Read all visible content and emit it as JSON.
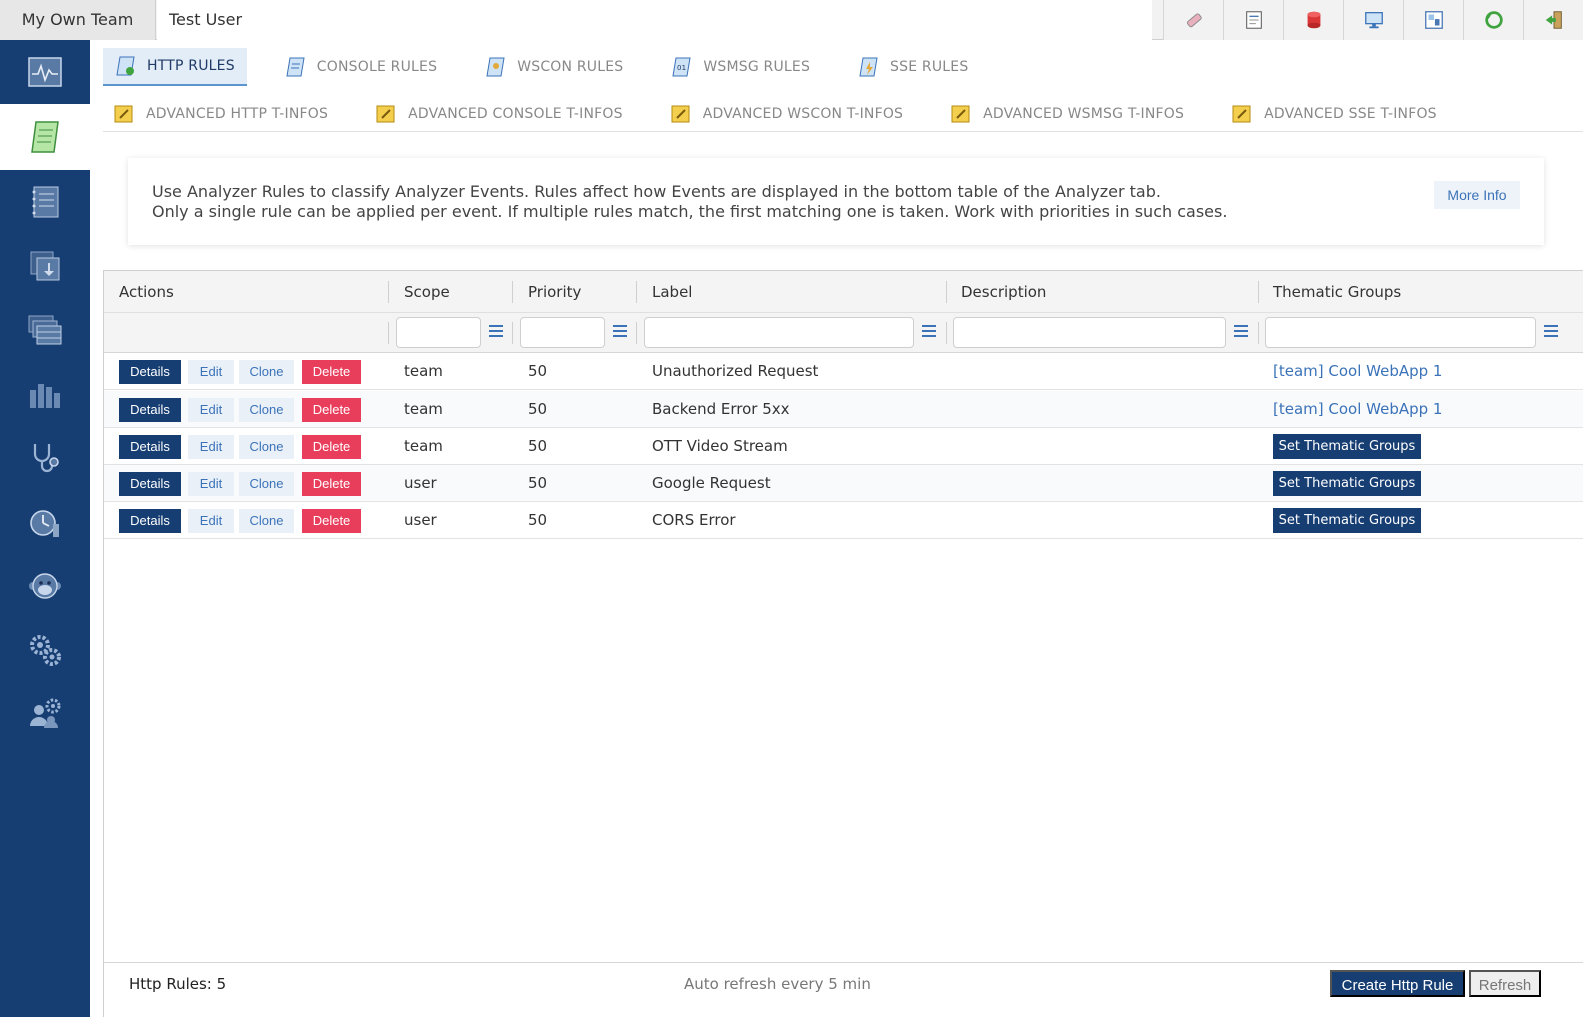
{
  "topbar": {
    "team": "My Own Team",
    "user": "Test User",
    "icons": [
      "eraser-icon",
      "report-icon",
      "database-icon",
      "monitor-icon",
      "layout-icon",
      "refresh-cycle-icon",
      "logout-icon"
    ]
  },
  "sidebar": {
    "items": [
      "analyzer-icon",
      "rules-scroll-icon",
      "notebook-icon",
      "download-icon",
      "tables-icon",
      "stats-icon",
      "stethoscope-icon",
      "timer-icon",
      "monkey-icon",
      "settings-gears-icon",
      "admin-users-icon"
    ],
    "active_index": 1
  },
  "tabs_primary": [
    {
      "label": "HTTP RULES",
      "active": true
    },
    {
      "label": "CONSOLE RULES"
    },
    {
      "label": "WSCON RULES"
    },
    {
      "label": "WSMSG RULES"
    },
    {
      "label": "SSE RULES"
    }
  ],
  "tabs_secondary": [
    {
      "label": "ADVANCED HTTP T-INFOS"
    },
    {
      "label": "ADVANCED CONSOLE T-INFOS"
    },
    {
      "label": "ADVANCED WSCON T-INFOS"
    },
    {
      "label": "ADVANCED WSMSG T-INFOS"
    },
    {
      "label": "ADVANCED SSE T-INFOS"
    }
  ],
  "info": {
    "line1": "Use Analyzer Rules to classify Analyzer Events. Rules affect how Events are displayed in the bottom table of the Analyzer tab.",
    "line2": "Only a single rule can be applied per event. If multiple rules match, the first matching one is taken. Work with priorities in such cases.",
    "more_info": "More Info"
  },
  "table": {
    "columns": [
      "Actions",
      "Scope",
      "Priority",
      "Label",
      "Description",
      "Thematic Groups"
    ],
    "action_labels": {
      "details": "Details",
      "edit": "Edit",
      "clone": "Clone",
      "delete": "Delete"
    },
    "set_groups_label": "Set Thematic Groups",
    "rows": [
      {
        "scope": "team",
        "priority": "50",
        "label": "Unauthorized Request",
        "description": "",
        "group": "[team] Cool WebApp 1"
      },
      {
        "scope": "team",
        "priority": "50",
        "label": "Backend Error 5xx",
        "description": "",
        "group": "[team] Cool WebApp 1"
      },
      {
        "scope": "team",
        "priority": "50",
        "label": "OTT Video Stream",
        "description": "",
        "group": ""
      },
      {
        "scope": "user",
        "priority": "50",
        "label": "Google Request",
        "description": "",
        "group": ""
      },
      {
        "scope": "user",
        "priority": "50",
        "label": "CORS Error",
        "description": "",
        "group": ""
      }
    ]
  },
  "footer": {
    "count": "Http Rules: 5",
    "auto_refresh": "Auto refresh every 5 min",
    "create": "Create Http Rule",
    "refresh": "Refresh"
  },
  "colors": {
    "primary": "#173e73",
    "link": "#3b73b9",
    "danger": "#e83e5c"
  }
}
